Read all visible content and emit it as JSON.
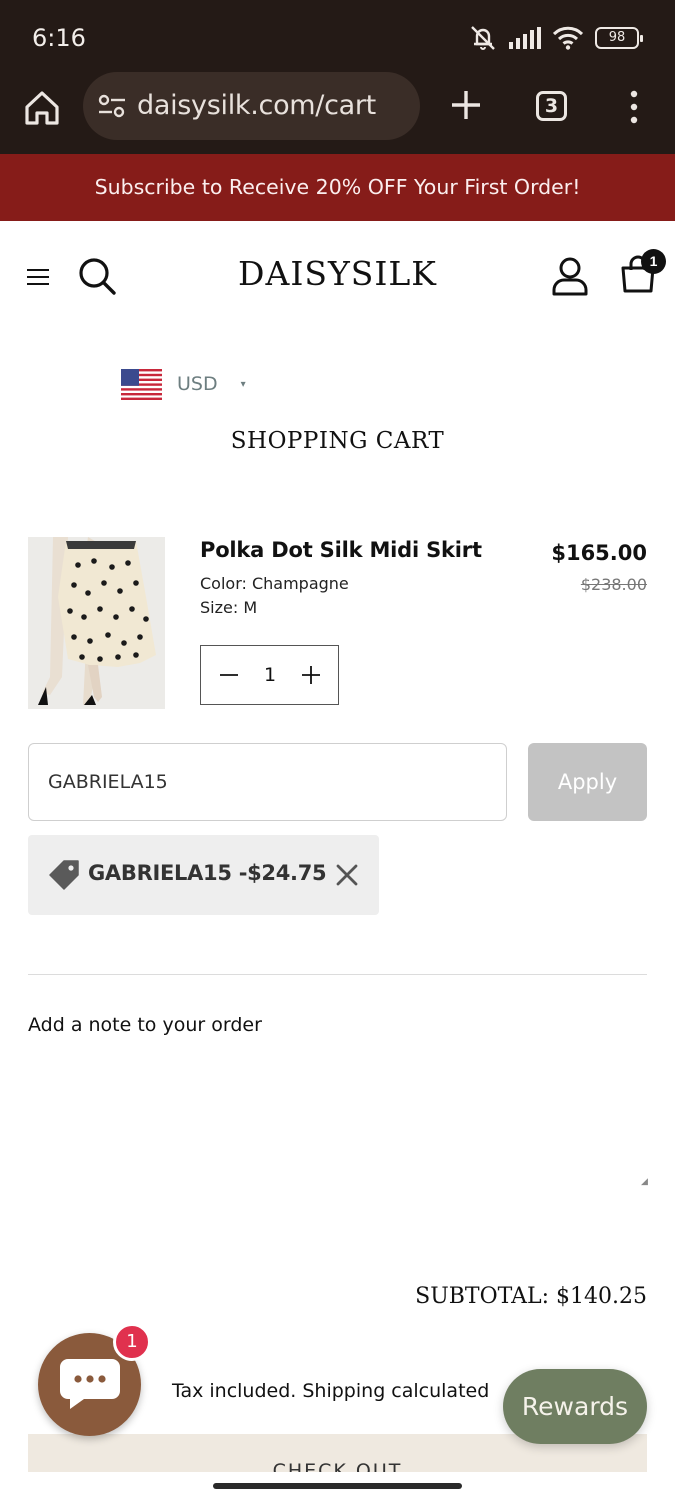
{
  "status_bar": {
    "time": "6:16",
    "battery": "98",
    "icons": [
      "mute-icon",
      "signal-icon",
      "wifi-icon",
      "battery-icon"
    ]
  },
  "browser": {
    "url": "daisysilk.com/cart",
    "tab_count": "3",
    "icons": [
      "home-icon",
      "site-settings-icon",
      "new-tab-icon",
      "tabs-icon",
      "overflow-menu-icon"
    ]
  },
  "promo": {
    "text": "Subscribe to Receive 20% OFF Your First Order!",
    "color": "#861c19"
  },
  "header": {
    "brand": "DAISYSILK",
    "cart_count": "1",
    "icons": [
      "menu-icon",
      "search-icon",
      "account-icon",
      "cart-icon"
    ]
  },
  "currency": {
    "code": "USD",
    "caret": "▾",
    "flag": "us-flag-icon"
  },
  "cart": {
    "heading": "SHOPPING CART",
    "item": {
      "name": "Polka Dot Silk Midi Skirt",
      "color": "Color: Champagne",
      "size": "Size: M",
      "price": "$165.00",
      "compare_price": "$238.00",
      "quantity": "1"
    },
    "discount": {
      "input_value": "GABRIELA15",
      "apply_label": "Apply",
      "applied": "GABRIELA15 -$24.75"
    },
    "note_label": "Add a note to your order",
    "subtotal": "SUBTOTAL: $140.25",
    "tax_note": "Tax included. Shipping calculated",
    "checkout_label": "CHECK OUT"
  },
  "widgets": {
    "chat_badge": "1",
    "rewards_label": "Rewards",
    "rewards_color": "#6f7e61",
    "chat_color": "#8a5a3c"
  }
}
